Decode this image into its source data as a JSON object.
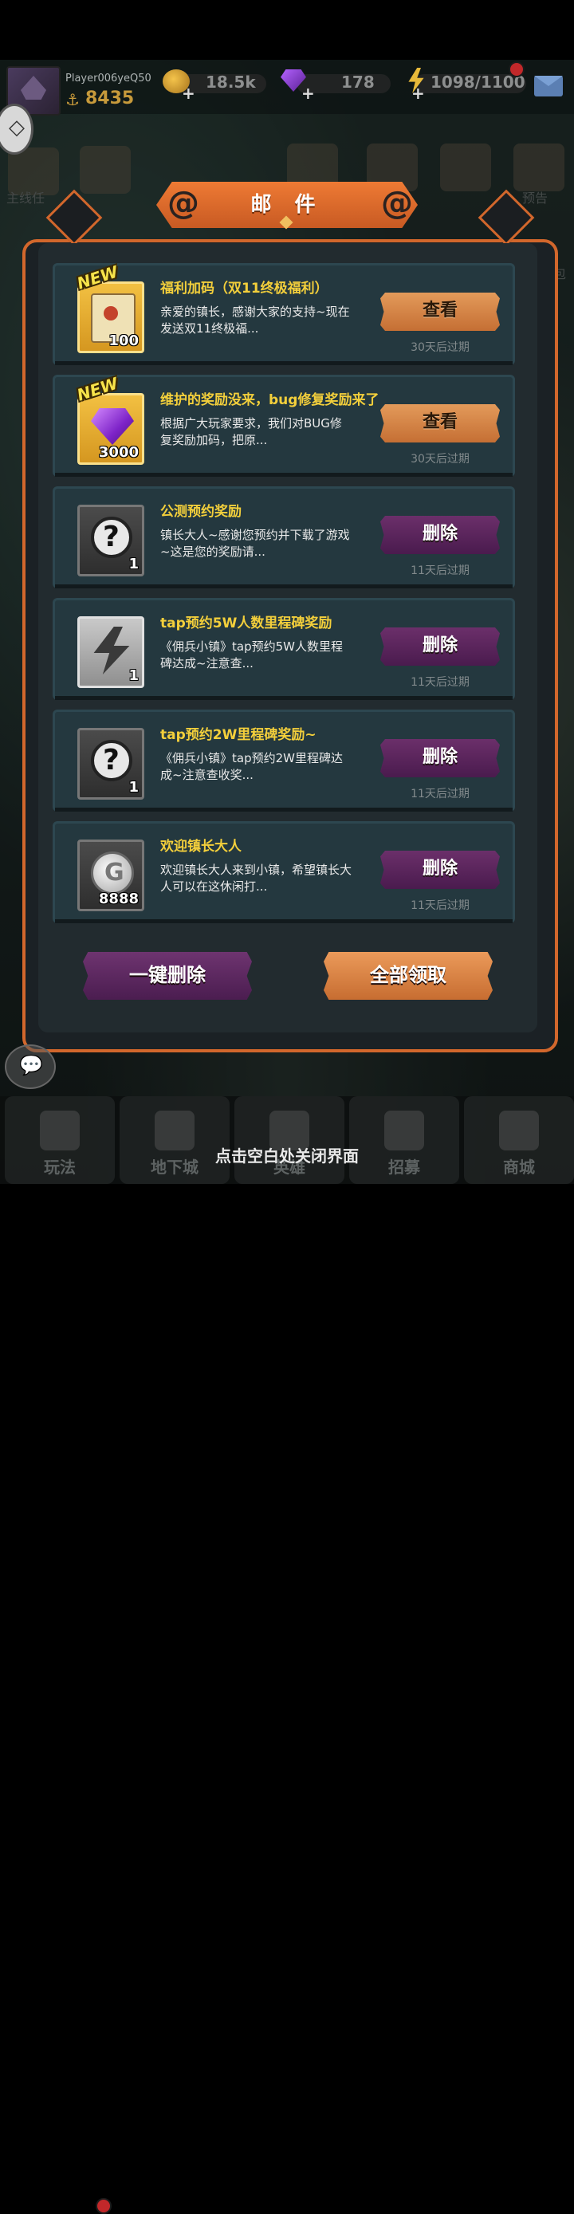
{
  "player": {
    "name": "Player006yeQ50",
    "score": "8435"
  },
  "resources": {
    "gold": "18.5k",
    "gems": "178",
    "energy": "1098/1100"
  },
  "scene_labels": {
    "left_task": "主线任",
    "right_preview": "预告",
    "right_gift": "礼包"
  },
  "mail_panel": {
    "title": "邮 件",
    "new_tag": "NEW",
    "mails": [
      {
        "title": "福利加码（双11终极福利）",
        "body": "亲爱的镇长，感谢大家的支持~现在发送双11终极福...",
        "item": "scroll",
        "count": "100",
        "is_new": true,
        "action": "查看",
        "action_type": "view",
        "expire": "30天后过期"
      },
      {
        "title": "维护的奖励没来，bug修复奖励来了",
        "body": "根据广大玩家要求，我们对BUG修复奖励加码，把原...",
        "item": "gem",
        "count": "3000",
        "is_new": true,
        "action": "查看",
        "action_type": "view",
        "expire": "30天后过期"
      },
      {
        "title": "公测预约奖励",
        "body": "镇长大人~感谢您预约并下载了游戏~这是您的奖励请...",
        "item": "question",
        "count": "1",
        "is_new": false,
        "action": "删除",
        "action_type": "delete",
        "expire": "11天后过期"
      },
      {
        "title": "tap预约5W人数里程碑奖励",
        "body": "《佣兵小镇》tap预约5W人数里程碑达成~注意查...",
        "item": "bolt",
        "count": "1",
        "is_new": false,
        "action": "删除",
        "action_type": "delete",
        "expire": "11天后过期"
      },
      {
        "title": "tap预约2W里程碑奖励~",
        "body": "《佣兵小镇》tap预约2W里程碑达成~注意查收奖...",
        "item": "question",
        "count": "1",
        "is_new": false,
        "action": "删除",
        "action_type": "delete",
        "expire": "11天后过期"
      },
      {
        "title": "欢迎镇长大人",
        "body": "欢迎镇长大人来到小镇，希望镇长大人可以在这休闲打...",
        "item": "coin",
        "count": "8888",
        "is_new": false,
        "action": "删除",
        "action_type": "delete",
        "expire": "11天后过期"
      }
    ],
    "delete_all_label": "一键删除",
    "claim_all_label": "全部领取"
  },
  "bottom_nav": [
    "玩法",
    "地下城",
    "英雄",
    "招募",
    "商城"
  ],
  "close_hint": "点击空白处关闭界面",
  "colors": {
    "accent_orange": "#d2672c",
    "title_yellow": "#f3cf3b",
    "view_button": "#c56f34",
    "delete_button": "#4a1b4e"
  }
}
